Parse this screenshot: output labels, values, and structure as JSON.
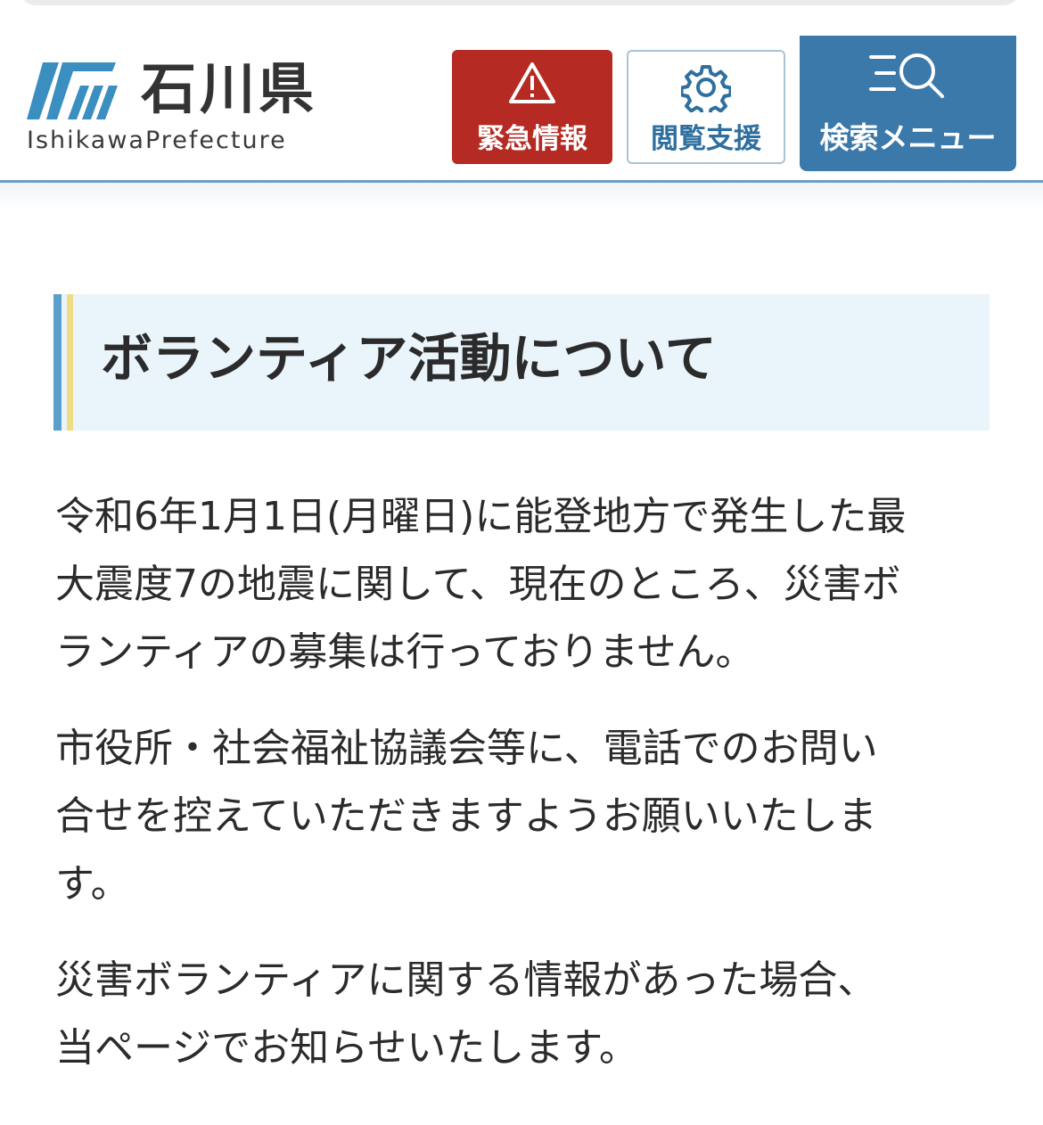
{
  "site": {
    "name": "石川県",
    "subtitle": "IshikawaPrefecture"
  },
  "header_buttons": {
    "emergency": {
      "label": "緊急情報",
      "icon": "warning-triangle-icon",
      "color": "#b52a22"
    },
    "accessibility": {
      "label": "閲覧支援",
      "icon": "gear-icon",
      "color": "#2e6f9f"
    },
    "search_menu": {
      "label": "検索メニュー",
      "icon": "menu-search-icon",
      "color": "#3b79aa"
    }
  },
  "page": {
    "title": "ボランティア活動について",
    "paragraphs": [
      {
        "lines": [
          "令和6年1月1日(月曜日)に能登地方で発生した最",
          "大震度7の地震に関して、現在のところ、災害ボ",
          "ランティアの募集は行っておりません。"
        ]
      },
      {
        "lines": [
          "市役所・社会福祉協議会等に、電話でのお問い",
          "合せを控えていただきますようお願いいたしま",
          "す。"
        ]
      },
      {
        "lines": [
          "災害ボランティアに関する情報があった場合、",
          "当ページでお知らせいたします。"
        ]
      }
    ]
  }
}
